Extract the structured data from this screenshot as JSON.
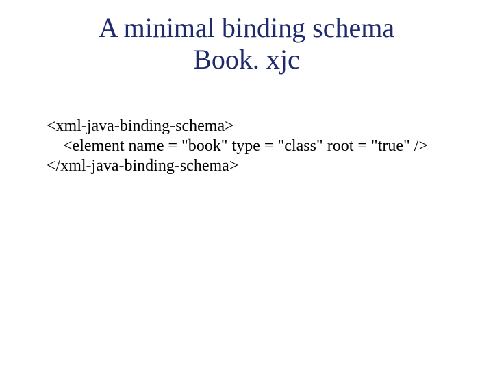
{
  "title": {
    "line1": "A minimal binding schema",
    "line2": "Book. xjc"
  },
  "code": {
    "line1": "<xml-java-binding-schema>",
    "line2": "    <element name = \"book\" type = \"class\" root = \"true\" />",
    "line3": "</xml-java-binding-schema>"
  }
}
